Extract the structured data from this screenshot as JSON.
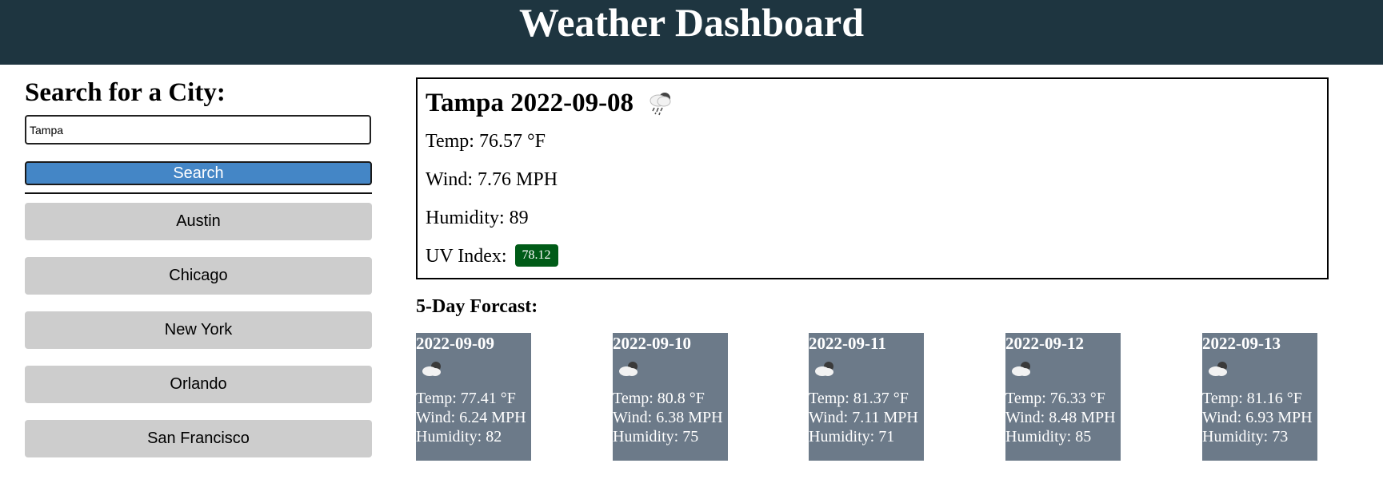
{
  "header": {
    "title": "Weather Dashboard"
  },
  "sidebar": {
    "title": "Search for a City:",
    "search_input": {
      "value": "Tampa",
      "placeholder": ""
    },
    "search_button_label": "Search",
    "history": [
      "Austin",
      "Chicago",
      "New York",
      "Orlando",
      "San Francisco"
    ]
  },
  "current": {
    "title": "Tampa 2022-09-08",
    "icon": "rain-cloud-icon",
    "temp": "Temp: 76.57 °F",
    "wind": "Wind: 7.76 MPH",
    "humidity": "Humidity: 89",
    "uv_label": "UV Index:",
    "uv_value": "78.12",
    "uv_color": "#005b17"
  },
  "forecast": {
    "title": "5-Day Forcast:",
    "card_color": "#6c7a89",
    "days": [
      {
        "date": "2022-09-09",
        "icon": "cloud-icon",
        "temp": "Temp: 77.41 °F",
        "wind": "Wind: 6.24 MPH",
        "humidity": "Humidity: 82"
      },
      {
        "date": "2022-09-10",
        "icon": "cloud-icon",
        "temp": "Temp: 80.8 °F",
        "wind": "Wind: 6.38 MPH",
        "humidity": "Humidity: 75"
      },
      {
        "date": "2022-09-11",
        "icon": "cloud-icon",
        "temp": "Temp: 81.37 °F",
        "wind": "Wind: 7.11 MPH",
        "humidity": "Humidity: 71"
      },
      {
        "date": "2022-09-12",
        "icon": "cloud-icon",
        "temp": "Temp: 76.33 °F",
        "wind": "Wind: 8.48 MPH",
        "humidity": "Humidity: 85"
      },
      {
        "date": "2022-09-13",
        "icon": "cloud-icon",
        "temp": "Temp: 81.16 °F",
        "wind": "Wind: 6.93 MPH",
        "humidity": "Humidity: 73"
      }
    ]
  },
  "colors": {
    "header_bg": "#1e3540",
    "search_button": "#4486c6",
    "history_button": "#cdcdcd"
  }
}
